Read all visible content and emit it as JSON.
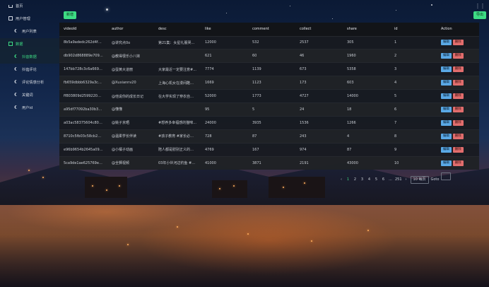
{
  "sidebar": {
    "items": [
      {
        "label": "首页",
        "level": 0,
        "icon": "house-icon"
      },
      {
        "label": "用户管理",
        "level": 0,
        "icon": "user-icon"
      },
      {
        "label": "用户列表",
        "level": 1,
        "icon": "moon-icon"
      },
      {
        "label": "数据",
        "level": 0,
        "icon": "data-icon",
        "active": true
      },
      {
        "label": "抖音数据",
        "level": 1,
        "icon": "moon-icon",
        "active": true
      },
      {
        "label": "抖音评论",
        "level": 1,
        "icon": "moon-icon"
      },
      {
        "label": "评论情感分析",
        "level": 1,
        "icon": "moon-icon"
      },
      {
        "label": "关键词",
        "level": 1,
        "icon": "moon-icon"
      },
      {
        "label": "用户id",
        "level": 1,
        "icon": "moon-icon"
      }
    ]
  },
  "toolbar": {
    "add_label": "新增",
    "export_label": "导出"
  },
  "table": {
    "columns": [
      "videoId",
      "author",
      "desc",
      "like",
      "comment",
      "collect",
      "share",
      "id",
      "Action"
    ],
    "rows": [
      [
        "8b5a9adedc262d4f54...",
        "@讲究点0o",
        "第21集：女星礼服哭哭...",
        "12000",
        "532",
        "2537",
        "305",
        "1"
      ],
      [
        "db902d868889e7094...",
        "@教得很乐小八妹",
        "",
        "621",
        "60",
        "46",
        "1960",
        "2"
      ],
      [
        "147bb728c3c6a6692...",
        "@蛋黄大道丽",
        "大家最近一定要注意#...",
        "7774",
        "1139",
        "673",
        "5358",
        "3"
      ],
      [
        "fb659dbbb6329a3cbc...",
        "@Xuxiannv20",
        "上海心机女在漫间酷陀...",
        "1669",
        "1123",
        "173",
        "603",
        "4"
      ],
      [
        "ff803809d2599220913...",
        "@他说你的成长日记",
        "在大学实现了穿衣自由...",
        "52000",
        "1773",
        "4727",
        "14000",
        "5"
      ],
      [
        "a95df77092ba30b3bc...",
        "@懂懂",
        "",
        "95",
        "5",
        "24",
        "18",
        "6"
      ],
      [
        "a03ac58375604c806e...",
        "@姚子京晒",
        "#想养多幸福感的猫咪...",
        "24000",
        "3935",
        "1536",
        "1266",
        "7"
      ],
      [
        "8710c5fb03c58cb224...",
        "@温柔学长伴读",
        "#孩子教育 #家长必看 #...",
        "728",
        "87",
        "243",
        "4",
        "8"
      ],
      [
        "e96b9654b2645a091f...",
        "@小橘子动画",
        "陪人都是慰别正义的化...",
        "4769",
        "167",
        "974",
        "87",
        "9"
      ],
      [
        "5ca9de1ae625769e5a...",
        "@全狮视频",
        "03年小伙河边钓鱼 #钓...",
        "41000",
        "3871",
        "2191",
        "43000",
        "10"
      ]
    ],
    "edit_label": "编辑",
    "delete_label": "删除"
  },
  "pager": {
    "prev": "‹",
    "pages": [
      "1",
      "2",
      "3",
      "4",
      "5",
      "6",
      "...",
      "251"
    ],
    "current": "1",
    "next": "›",
    "size_label": "10 每页",
    "goto_label": "Goto"
  }
}
